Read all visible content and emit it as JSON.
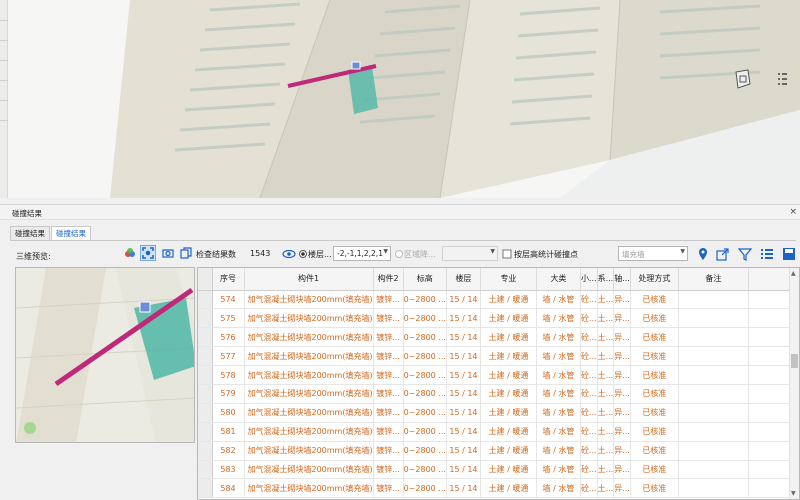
{
  "panel": {
    "title": "碰撞结果",
    "close": "×"
  },
  "tabs": [
    {
      "label": "碰撞结果",
      "active": false
    },
    {
      "label": "碰撞结果",
      "active": true
    }
  ],
  "preview": {
    "label": "三维预览:"
  },
  "toolbar": {
    "check_count_label": "检查结果数",
    "check_count_value": "1543",
    "floor_radio_label": "楼层...",
    "floor_value": "-2,-1,1,2,2,1",
    "region_radio_label": "区域降...",
    "region_value": "",
    "by_floor_label": "按层高统计碰撞点",
    "filter_value": "填充墙"
  },
  "colors": {
    "accent": "#1a64c8",
    "row_text": "#d2691e",
    "pipe": "#c0287a",
    "box": "#4fb7a6"
  },
  "table": {
    "columns": [
      "序号",
      "构件1",
      "构件2",
      "标高",
      "楼层",
      "专业",
      "大类",
      "小...",
      "系...",
      "轴...",
      "处理方式",
      "备注"
    ],
    "rows": [
      [
        "574",
        "加气混凝土砌块墙200mm(填充墙)",
        "镀锌...",
        "0~2800 ...",
        "15 / 14",
        "土建 / 暖通",
        "墙 / 水管",
        "砼...",
        "土...",
        "异...",
        "已核准",
        ""
      ],
      [
        "575",
        "加气混凝土砌块墙200mm(填充墙)",
        "镀锌...",
        "0~2800 ...",
        "15 / 14",
        "土建 / 暖通",
        "墙 / 水管",
        "砼...",
        "土...",
        "异...",
        "已核准",
        ""
      ],
      [
        "576",
        "加气混凝土砌块墙200mm(填充墙)",
        "镀锌...",
        "0~2800 ...",
        "15 / 14",
        "土建 / 暖通",
        "墙 / 水管",
        "砼...",
        "土...",
        "异...",
        "已核准",
        ""
      ],
      [
        "577",
        "加气混凝土砌块墙200mm(填充墙)",
        "镀锌...",
        "0~2800 ...",
        "15 / 14",
        "土建 / 暖通",
        "墙 / 水管",
        "砼...",
        "土...",
        "异...",
        "已核准",
        ""
      ],
      [
        "578",
        "加气混凝土砌块墙200mm(填充墙)",
        "镀锌...",
        "0~2800 ...",
        "15 / 14",
        "土建 / 暖通",
        "墙 / 水管",
        "砼...",
        "土...",
        "异...",
        "已核准",
        ""
      ],
      [
        "579",
        "加气混凝土砌块墙200mm(填充墙)",
        "镀锌...",
        "0~2800 ...",
        "15 / 14",
        "土建 / 暖通",
        "墙 / 水管",
        "砼...",
        "土...",
        "异...",
        "已核准",
        ""
      ],
      [
        "580",
        "加气混凝土砌块墙200mm(填充墙)",
        "镀锌...",
        "0~2800 ...",
        "15 / 14",
        "土建 / 暖通",
        "墙 / 水管",
        "砼...",
        "土...",
        "异...",
        "已核准",
        ""
      ],
      [
        "581",
        "加气混凝土砌块墙200mm(填充墙)",
        "镀锌...",
        "0~2800 ...",
        "15 / 14",
        "土建 / 暖通",
        "墙 / 水管",
        "砼...",
        "土...",
        "异...",
        "已核准",
        ""
      ],
      [
        "582",
        "加气混凝土砌块墙200mm(填充墙)",
        "镀锌...",
        "0~2800 ...",
        "15 / 14",
        "土建 / 暖通",
        "墙 / 水管",
        "砼...",
        "土...",
        "异...",
        "已核准",
        ""
      ],
      [
        "583",
        "加气混凝土砌块墙200mm(填充墙)",
        "镀锌...",
        "0~2800 ...",
        "15 / 14",
        "土建 / 暖通",
        "墙 / 水管",
        "砼...",
        "土...",
        "异...",
        "已核准",
        ""
      ],
      [
        "584",
        "加气混凝土砌块墙200mm(填充墙)",
        "镀锌...",
        "0~2800 ...",
        "15 / 14",
        "土建 / 暖通",
        "墙 / 水管",
        "砼...",
        "土...",
        "异...",
        "已核准",
        ""
      ]
    ]
  }
}
